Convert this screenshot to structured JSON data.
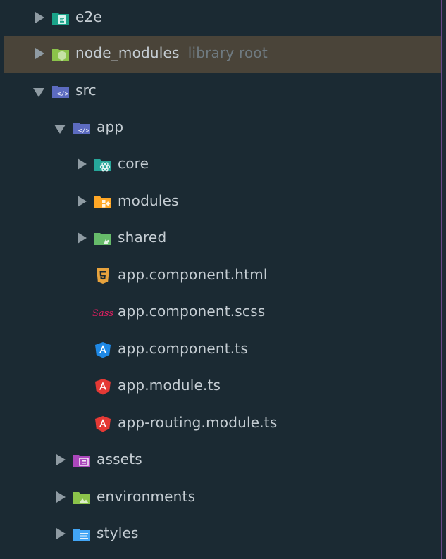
{
  "tree": {
    "items": [
      {
        "label": "e2e",
        "sublabel": "",
        "icon": "folder-e2e-icon",
        "color": "#1aa389"
      },
      {
        "label": "node_modules",
        "sublabel": "library root",
        "icon": "folder-node-icon",
        "color": "#8bc34a"
      },
      {
        "label": "src",
        "sublabel": "",
        "icon": "folder-src-icon",
        "color": "#5c6bc0"
      },
      {
        "label": "app",
        "sublabel": "",
        "icon": "folder-app-icon",
        "color": "#5c6bc0"
      },
      {
        "label": "core",
        "sublabel": "",
        "icon": "folder-core-icon",
        "color": "#26a69a"
      },
      {
        "label": "modules",
        "sublabel": "",
        "icon": "folder-modules-icon",
        "color": "#ffa726"
      },
      {
        "label": "shared",
        "sublabel": "",
        "icon": "folder-shared-icon",
        "color": "#66bb6a"
      },
      {
        "label": "app.component.html",
        "sublabel": "",
        "icon": "html5-icon",
        "color": "#e8a33d"
      },
      {
        "label": "app.component.scss",
        "sublabel": "",
        "icon": "sass-icon",
        "color": "#e91e63"
      },
      {
        "label": "app.component.ts",
        "sublabel": "",
        "icon": "angular-component-icon",
        "color": "#1e88e5"
      },
      {
        "label": "app.module.ts",
        "sublabel": "",
        "icon": "angular-icon",
        "color": "#e53935"
      },
      {
        "label": "app-routing.module.ts",
        "sublabel": "",
        "icon": "angular-icon",
        "color": "#e53935"
      },
      {
        "label": "assets",
        "sublabel": "",
        "icon": "folder-assets-icon",
        "color": "#ab47bc"
      },
      {
        "label": "environments",
        "sublabel": "",
        "icon": "folder-environments-icon",
        "color": "#8bc34a"
      },
      {
        "label": "styles",
        "sublabel": "",
        "icon": "folder-styles-icon",
        "color": "#42a5f5"
      }
    ]
  }
}
